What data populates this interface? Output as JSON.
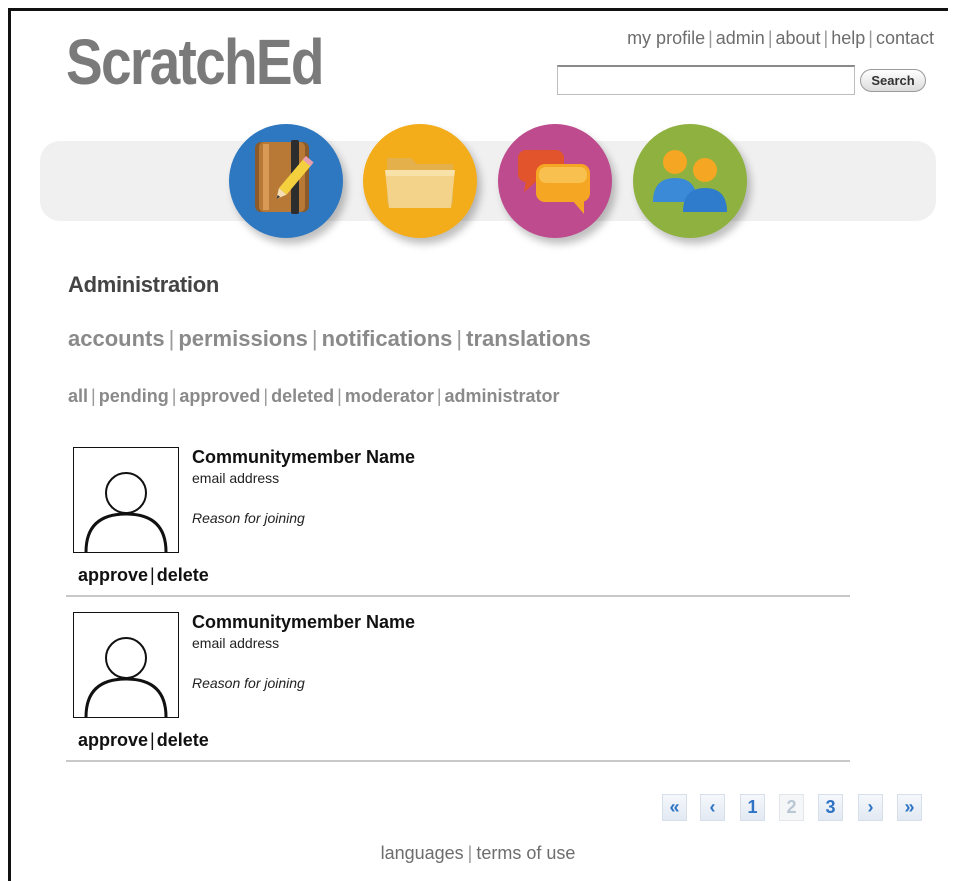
{
  "brand": {
    "logo_text": "ScratchEd"
  },
  "top_links": [
    "my profile",
    "admin",
    "about",
    "help",
    "contact"
  ],
  "search": {
    "value": "",
    "button_label": "Search"
  },
  "nav_icons": [
    {
      "name": "notebook-icon",
      "color": "#2d78c0"
    },
    {
      "name": "folder-icon",
      "color": "#f3ac1a"
    },
    {
      "name": "chat-bubbles-icon",
      "color": "#bd4b8e"
    },
    {
      "name": "people-icon",
      "color": "#8fb13f"
    }
  ],
  "page": {
    "heading": "Administration"
  },
  "tabs": [
    "accounts",
    "permissions",
    "notifications",
    "translations"
  ],
  "filters": [
    "all",
    "pending",
    "approved",
    "deleted",
    "moderator",
    "administrator"
  ],
  "members": [
    {
      "name": "Communitymember Name",
      "email": "email address",
      "reason": "Reason for joining",
      "approve_label": "approve",
      "delete_label": "delete"
    },
    {
      "name": "Communitymember Name",
      "email": "email address",
      "reason": "Reason for joining",
      "approve_label": "approve",
      "delete_label": "delete"
    }
  ],
  "pagination": {
    "first": "«",
    "prev": "‹",
    "pages": [
      "1",
      "2",
      "3"
    ],
    "current": "2",
    "next": "›",
    "last": "»"
  },
  "footer": {
    "links": [
      "languages",
      "terms of use"
    ]
  }
}
